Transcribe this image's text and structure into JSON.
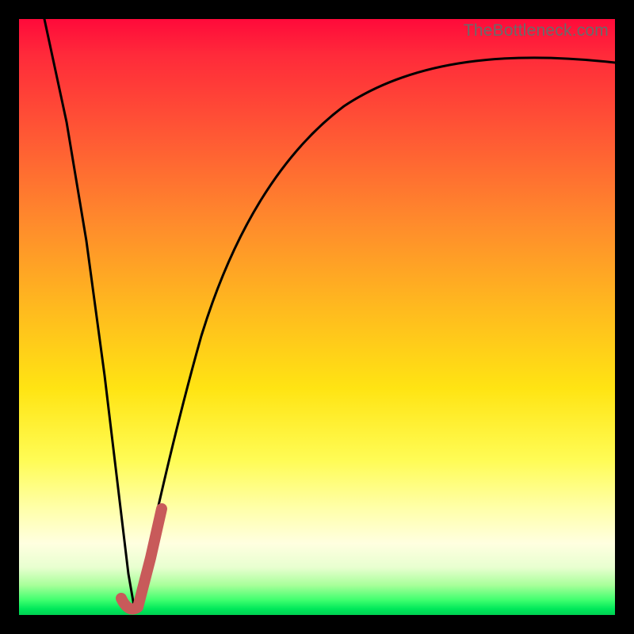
{
  "watermark": {
    "text": "TheBottleneck.com"
  },
  "colors": {
    "frame": "#000000",
    "gradient_top": "#ff0a3a",
    "gradient_mid_orange": "#ff8a2c",
    "gradient_mid_yellow": "#ffe413",
    "gradient_pale": "#ffffe0",
    "gradient_green": "#00e85a",
    "curve_stroke": "#000000",
    "marker_stroke": "#c85a5a"
  },
  "chart_data": {
    "type": "line",
    "title": "",
    "xlabel": "",
    "ylabel": "",
    "x_range": [
      0,
      100
    ],
    "y_range": [
      0,
      100
    ],
    "note": "V-shaped bottleneck curve. Left branch drops linearly from top-left corner to a minimum near x≈15. Right branch rises steeply then asymptotically toward ~90% at the right edge. A short salmon marker segment highlights the curve just right of the minimum, spanning roughly x≈15 to x≈19.",
    "series": [
      {
        "name": "left_branch",
        "x": [
          0,
          3,
          6,
          9,
          12,
          14,
          15
        ],
        "y": [
          100,
          80,
          60,
          40,
          20,
          6,
          0
        ]
      },
      {
        "name": "right_branch",
        "x": [
          15,
          17,
          19,
          22,
          26,
          30,
          35,
          40,
          46,
          54,
          62,
          72,
          84,
          100
        ],
        "y": [
          0,
          8,
          18,
          30,
          42,
          52,
          60,
          66,
          72,
          77,
          81,
          85,
          88,
          90
        ]
      }
    ],
    "marker": {
      "name": "highlight_segment",
      "color": "#c85a5a",
      "x": [
        14.2,
        15.0,
        16.2,
        17.6,
        19.0
      ],
      "y": [
        2.5,
        0.5,
        5.0,
        12.0,
        19.0
      ]
    }
  }
}
